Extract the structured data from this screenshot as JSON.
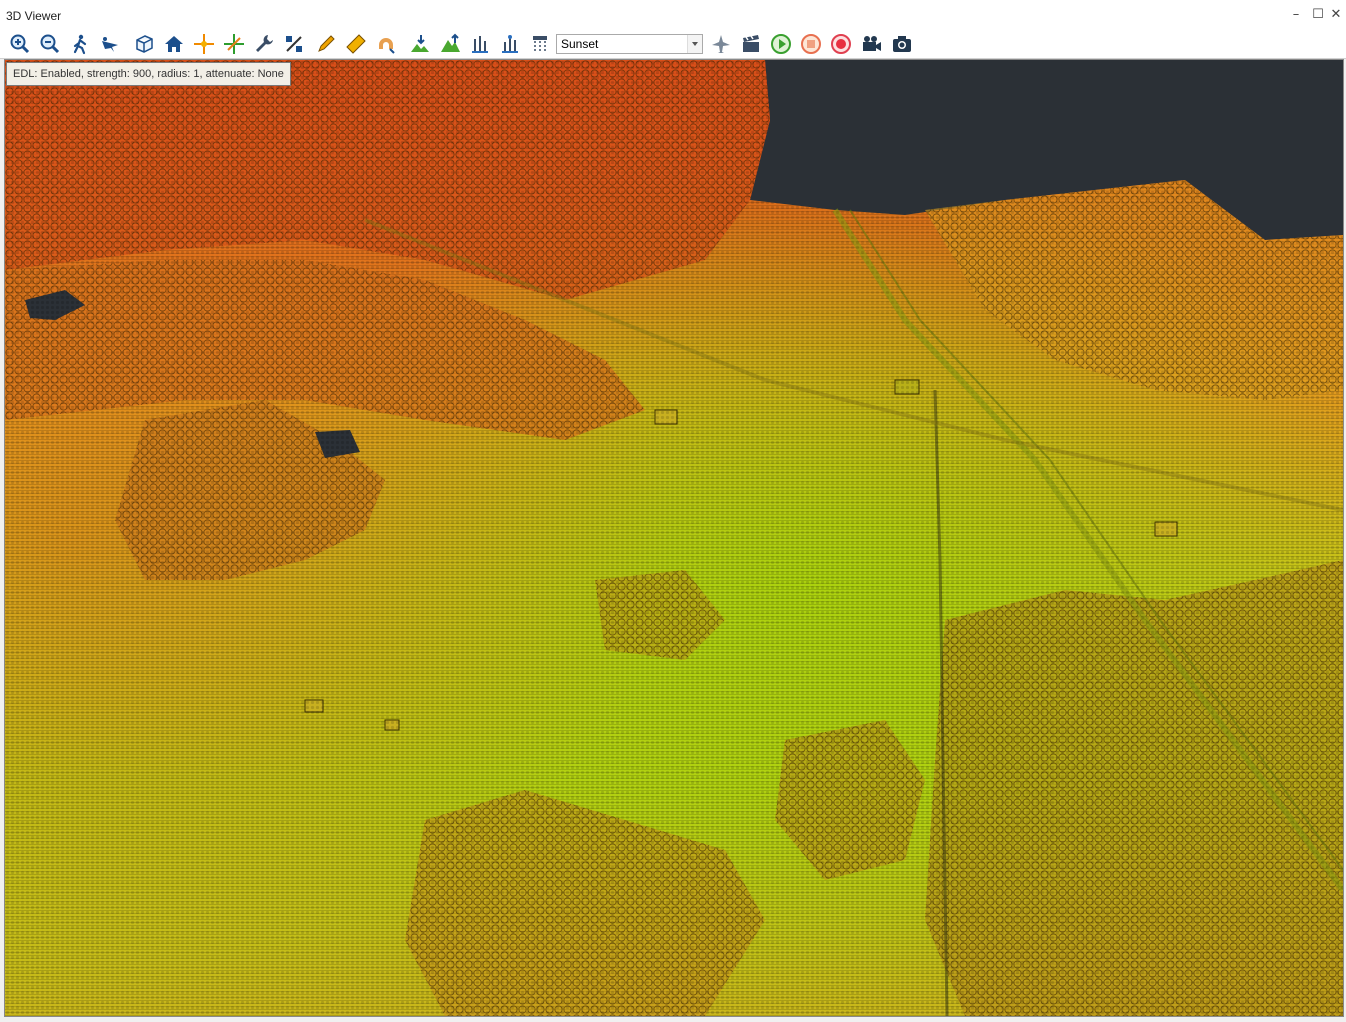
{
  "window": {
    "title": "3D Viewer",
    "minimize_glyph": "–",
    "maximize_glyph": "☐",
    "close_glyph": "✕"
  },
  "toolbar": {
    "tools": [
      "zoom-in-icon",
      "zoom-out-icon",
      "walk-icon",
      "fly-icon",
      "cube-icon",
      "home-icon",
      "crosshair-orange-icon",
      "crosshair-green-icon",
      "wrench-icon",
      "percent-icon",
      "pencil-icon",
      "ruler-icon",
      "magnet-icon",
      "terrain-icon",
      "mountain-icon",
      "water-level-icon",
      "water-level-2-icon",
      "lidar-icon"
    ],
    "colormap": {
      "selected": "Sunset"
    },
    "after_tools": [
      "airplane-icon",
      "clapper-icon",
      "play-icon",
      "stop-icon",
      "record-icon",
      "video-camera-icon",
      "camera-icon"
    ]
  },
  "viewport": {
    "status_text": "EDL: Enabled, strength: 900, radius: 1, attenuate: None",
    "colors": {
      "sky": "#2b3036",
      "high": "#e0401a",
      "mid": "#e6a020",
      "low": "#a8d20e"
    }
  }
}
